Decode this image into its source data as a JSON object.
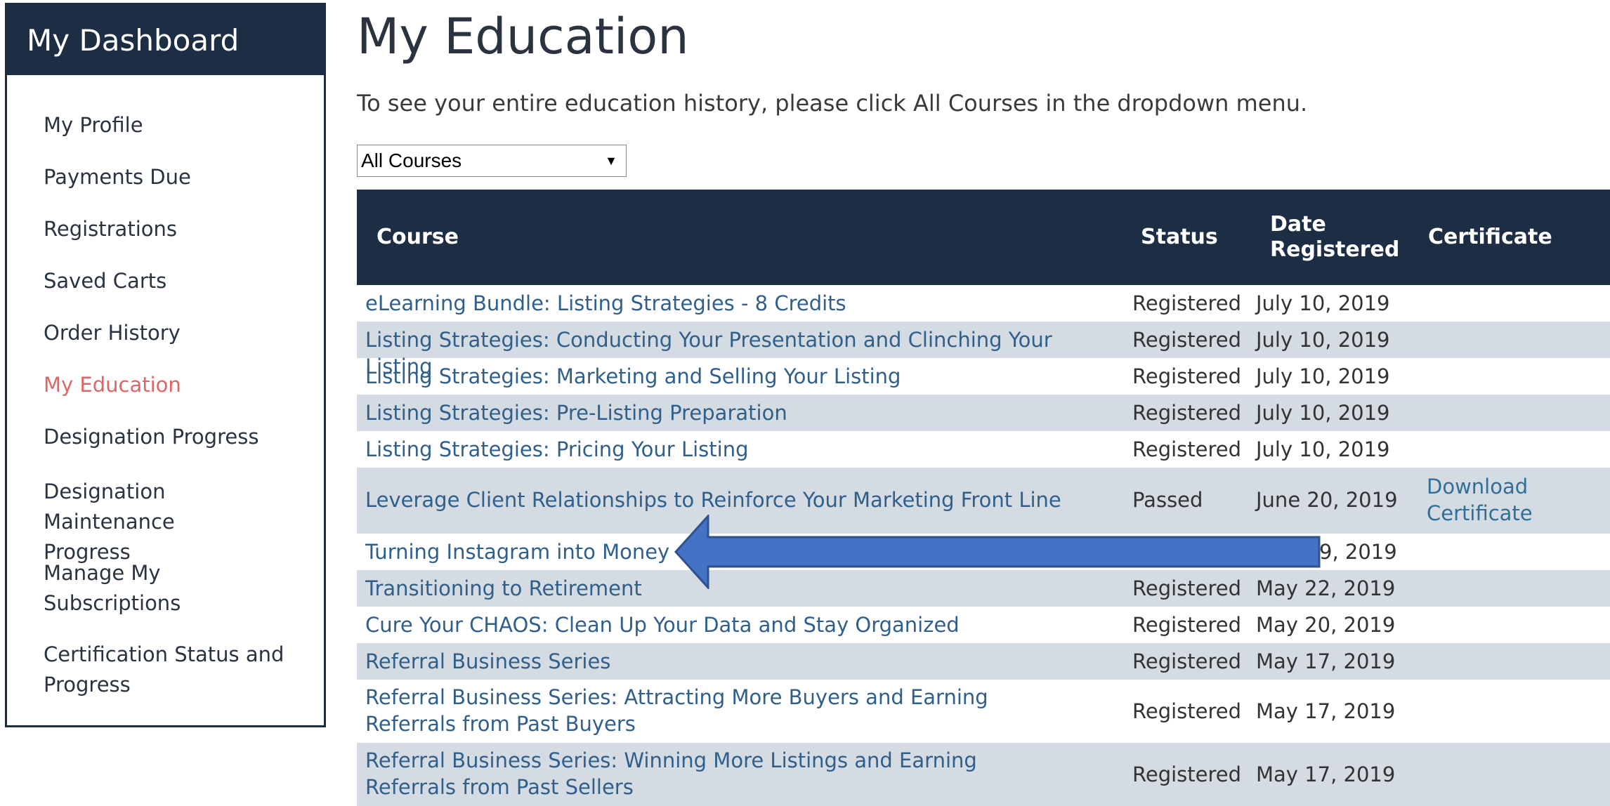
{
  "sidebar": {
    "title": "My Dashboard",
    "items": [
      {
        "label": "My Profile"
      },
      {
        "label": "Payments Due"
      },
      {
        "label": "Registrations"
      },
      {
        "label": "Saved Carts"
      },
      {
        "label": "Order History"
      },
      {
        "label": "My Education"
      },
      {
        "label": "Designation Progress"
      },
      {
        "label": "Designation Maintenance Progress"
      },
      {
        "label": "Manage My Subscriptions"
      },
      {
        "label": "Certification Status and Progress"
      }
    ],
    "active_color": "#e06666",
    "header_color": "#1d2d44"
  },
  "main": {
    "title": "My Education",
    "instructions": "To see your entire education history, please click All Courses in the dropdown menu.",
    "filter": {
      "selected": "All Courses"
    }
  },
  "table": {
    "columns": {
      "course": "Course",
      "status": "Status",
      "date": "Date Registered",
      "certificate": "Certificate"
    },
    "rows": [
      {
        "course": "eLearning Bundle: Listing Strategies - 8 Credits",
        "status": "Registered",
        "date": "July 10, 2019",
        "certificate": ""
      },
      {
        "course": "Listing Strategies: Conducting Your Presentation and Clinching Your Listing",
        "status": "Registered",
        "date": "July 10, 2019",
        "certificate": ""
      },
      {
        "course": "Listing Strategies: Marketing and Selling Your Listing",
        "status": "Registered",
        "date": "July 10, 2019",
        "certificate": ""
      },
      {
        "course": "Listing Strategies: Pre-Listing Preparation",
        "status": "Registered",
        "date": "July 10, 2019",
        "certificate": ""
      },
      {
        "course": "Listing Strategies: Pricing Your Listing",
        "status": "Registered",
        "date": "July 10, 2019",
        "certificate": ""
      },
      {
        "course": "Leverage Client Relationships to Reinforce Your Marketing Front Line",
        "status": "Passed",
        "date": "June 20, 2019",
        "certificate": "Download Certificate"
      },
      {
        "course": "Turning Instagram into Money",
        "status": "",
        "date": "9, 2019",
        "certificate": ""
      },
      {
        "course": "Transitioning to Retirement",
        "status": "Registered",
        "date": "May 22, 2019",
        "certificate": ""
      },
      {
        "course": "Cure Your CHAOS: Clean Up Your Data and Stay Organized",
        "status": "Registered",
        "date": "May 20, 2019",
        "certificate": ""
      },
      {
        "course": "Referral Business Series",
        "status": "Registered",
        "date": "May 17, 2019",
        "certificate": ""
      },
      {
        "course": "Referral Business Series: Attracting More Buyers and Earning Referrals from Past Buyers",
        "status": "Registered",
        "date": "May 17, 2019",
        "certificate": ""
      },
      {
        "course": "Referral Business Series: Winning More Listings and Earning Referrals from Past Sellers",
        "status": "Registered",
        "date": "May 17, 2019",
        "certificate": ""
      }
    ]
  },
  "annotation": {
    "arrow_color": "#4472c4",
    "arrow_outline": "#2f528f"
  }
}
